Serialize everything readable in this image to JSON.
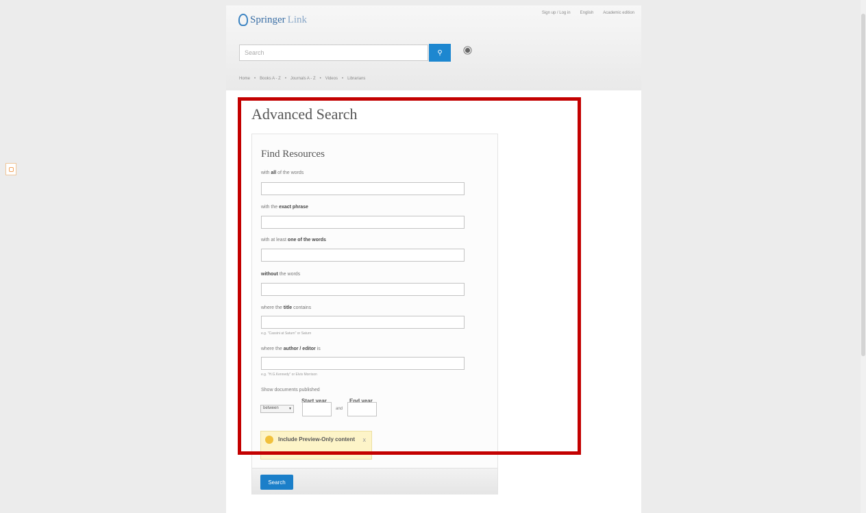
{
  "top_links": [
    "Sign up / Log in",
    "English",
    "Academic edition"
  ],
  "logo": {
    "brand": "Springer",
    "sub": "Link"
  },
  "search": {
    "placeholder": "Search",
    "icon": "search-icon"
  },
  "breadcrumb": [
    "Home",
    "•",
    "Books A - Z",
    "•",
    "Journals A - Z",
    "•",
    "Videos",
    "•",
    "Librarians"
  ],
  "page_title": "Advanced Search",
  "panel_title": "Find Resources",
  "fields": {
    "all_words": {
      "pre": "with ",
      "bold": "all",
      "post": " of the words"
    },
    "exact_phrase": {
      "pre": "with the ",
      "bold": "exact phrase",
      "post": ""
    },
    "one_of": {
      "pre": "with at least ",
      "bold": "one of the words",
      "post": ""
    },
    "without": {
      "pre": "",
      "bold": "without",
      "post": " the words"
    },
    "title": {
      "pre": "where the ",
      "bold": "title",
      "post": " contains",
      "hint": "e.g. \"Cassini at Saturn\" or Saturn"
    },
    "author": {
      "pre": "where the ",
      "bold": "author / editor",
      "post": " is",
      "hint": "e.g. \"H.G.Kennedy\" or Elvis Morrison"
    }
  },
  "published": {
    "label": "Show documents published",
    "start_label": "Start year",
    "end_label": "End year",
    "select_value": "between",
    "and_label": "and"
  },
  "preview": {
    "text": "Include Preview-Only content",
    "close": "x"
  },
  "submit_label": "Search",
  "colors": {
    "accent": "#1d87d0",
    "highlight_outline": "#c30000",
    "preview_bg": "#fdf4c8"
  }
}
